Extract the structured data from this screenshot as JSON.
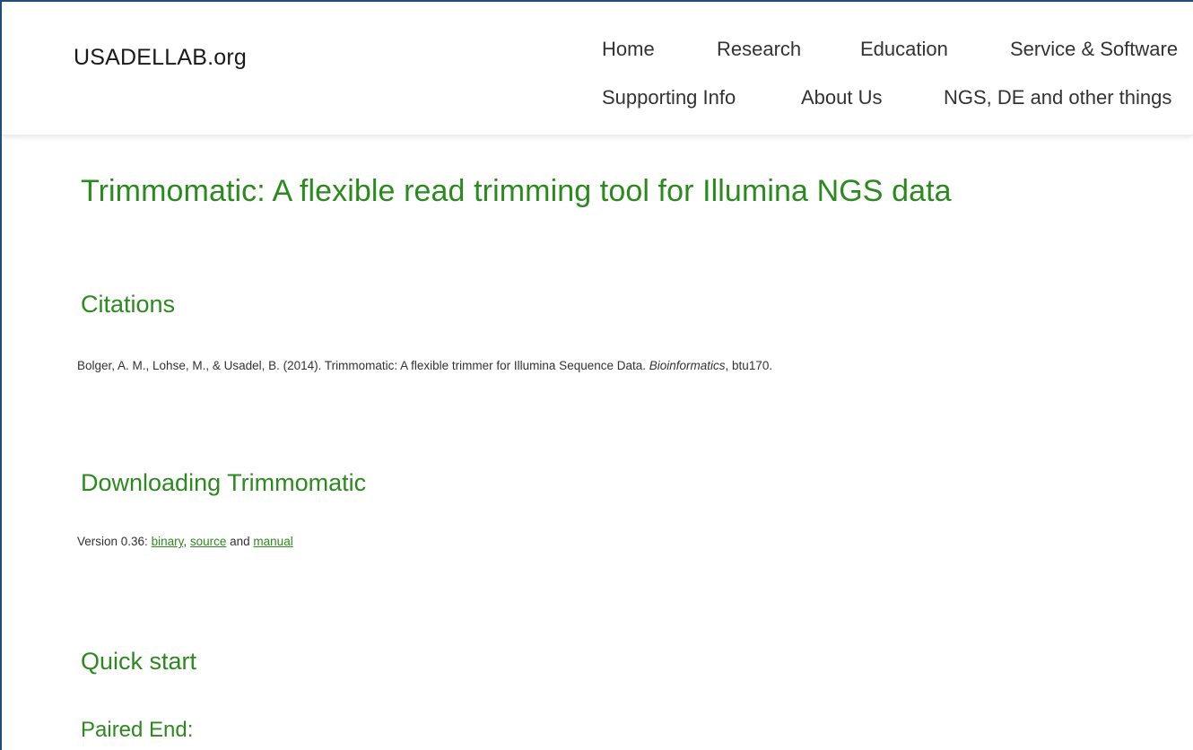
{
  "header": {
    "logo": "USADELLAB.org",
    "nav": {
      "home": "Home",
      "research": "Research",
      "education": "Education",
      "service_software": "Service & Software",
      "supporting_info": "Supporting Info",
      "about_us": "About Us",
      "ngs_de": "NGS, DE and other things"
    }
  },
  "main": {
    "title": "Trimmomatic: A flexible read trimming tool for Illumina NGS data",
    "citations": {
      "heading": "Citations",
      "text_before": "Bolger, A. M., Lohse, M., & Usadel, B. (2014). Trimmomatic: A flexible trimmer for Illumina Sequence Data. ",
      "journal": "Bioinformatics",
      "text_after": ", btu170."
    },
    "download": {
      "heading": "Downloading Trimmomatic",
      "version_prefix": "Version 0.36: ",
      "binary_link": "binary",
      "comma": ", ",
      "source_link": "source",
      "and_text": " and ",
      "manual_link": "manual"
    },
    "quick_start": {
      "heading": "Quick start"
    },
    "paired_end": {
      "heading": "Paired End:"
    }
  },
  "colors": {
    "accent_green": "#2b8a1e",
    "frame_border": "#1f4e79",
    "nav_text": "#333333"
  }
}
